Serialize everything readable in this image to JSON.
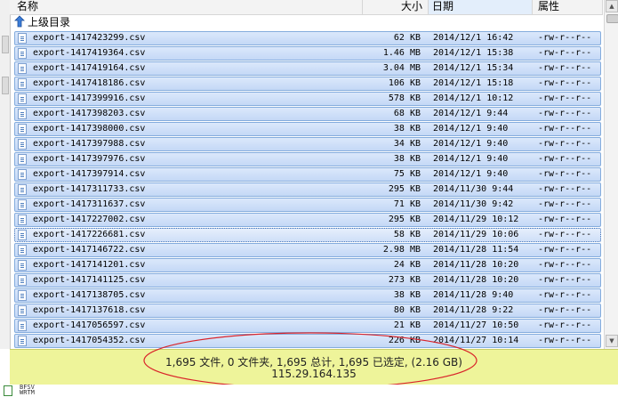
{
  "header": {
    "name": "名称",
    "size": "大小",
    "date": "日期",
    "perm": "属性"
  },
  "parent": {
    "label": "上级目录"
  },
  "files": [
    {
      "name": "export-1417423299.csv",
      "size": "62 KB",
      "date": "2014/12/1 16:42",
      "perm": "-rw-r--r--"
    },
    {
      "name": "export-1417419364.csv",
      "size": "1.46 MB",
      "date": "2014/12/1 15:38",
      "perm": "-rw-r--r--"
    },
    {
      "name": "export-1417419164.csv",
      "size": "3.04 MB",
      "date": "2014/12/1 15:34",
      "perm": "-rw-r--r--"
    },
    {
      "name": "export-1417418186.csv",
      "size": "106 KB",
      "date": "2014/12/1 15:18",
      "perm": "-rw-r--r--"
    },
    {
      "name": "export-1417399916.csv",
      "size": "578 KB",
      "date": "2014/12/1 10:12",
      "perm": "-rw-r--r--"
    },
    {
      "name": "export-1417398203.csv",
      "size": "68 KB",
      "date": "2014/12/1 9:44",
      "perm": "-rw-r--r--"
    },
    {
      "name": "export-1417398000.csv",
      "size": "38 KB",
      "date": "2014/12/1 9:40",
      "perm": "-rw-r--r--"
    },
    {
      "name": "export-1417397988.csv",
      "size": "34 KB",
      "date": "2014/12/1 9:40",
      "perm": "-rw-r--r--"
    },
    {
      "name": "export-1417397976.csv",
      "size": "38 KB",
      "date": "2014/12/1 9:40",
      "perm": "-rw-r--r--"
    },
    {
      "name": "export-1417397914.csv",
      "size": "75 KB",
      "date": "2014/12/1 9:40",
      "perm": "-rw-r--r--"
    },
    {
      "name": "export-1417311733.csv",
      "size": "295 KB",
      "date": "2014/11/30 9:44",
      "perm": "-rw-r--r--"
    },
    {
      "name": "export-1417311637.csv",
      "size": "71 KB",
      "date": "2014/11/30 9:42",
      "perm": "-rw-r--r--"
    },
    {
      "name": "export-1417227002.csv",
      "size": "295 KB",
      "date": "2014/11/29 10:12",
      "perm": "-rw-r--r--"
    },
    {
      "name": "export-1417226681.csv",
      "size": "58 KB",
      "date": "2014/11/29 10:06",
      "perm": "-rw-r--r--"
    },
    {
      "name": "export-1417146722.csv",
      "size": "2.98 MB",
      "date": "2014/11/28 11:54",
      "perm": "-rw-r--r--"
    },
    {
      "name": "export-1417141201.csv",
      "size": "24 KB",
      "date": "2014/11/28 10:20",
      "perm": "-rw-r--r--"
    },
    {
      "name": "export-1417141125.csv",
      "size": "273 KB",
      "date": "2014/11/28 10:20",
      "perm": "-rw-r--r--"
    },
    {
      "name": "export-1417138705.csv",
      "size": "38 KB",
      "date": "2014/11/28 9:40",
      "perm": "-rw-r--r--"
    },
    {
      "name": "export-1417137618.csv",
      "size": "80 KB",
      "date": "2014/11/28 9:22",
      "perm": "-rw-r--r--"
    },
    {
      "name": "export-1417056597.csv",
      "size": "21 KB",
      "date": "2014/11/27 10:50",
      "perm": "-rw-r--r--"
    },
    {
      "name": "export-1417054352.csv",
      "size": "226 KB",
      "date": "2014/11/27 10:14",
      "perm": "-rw-r--r--"
    }
  ],
  "status": {
    "summary": "1,695 文件, 0 文件夹, 1,695 总计, 1,695 已选定, (2.16 GB)",
    "host": "115.29.164.135"
  },
  "bottom": {
    "line1": "BFSV",
    "line2": "WRTM"
  },
  "colors": {
    "selected_row": "#c4d8f6",
    "status_bar": "#eef49a",
    "annotation_ellipse": "#d9232a"
  }
}
